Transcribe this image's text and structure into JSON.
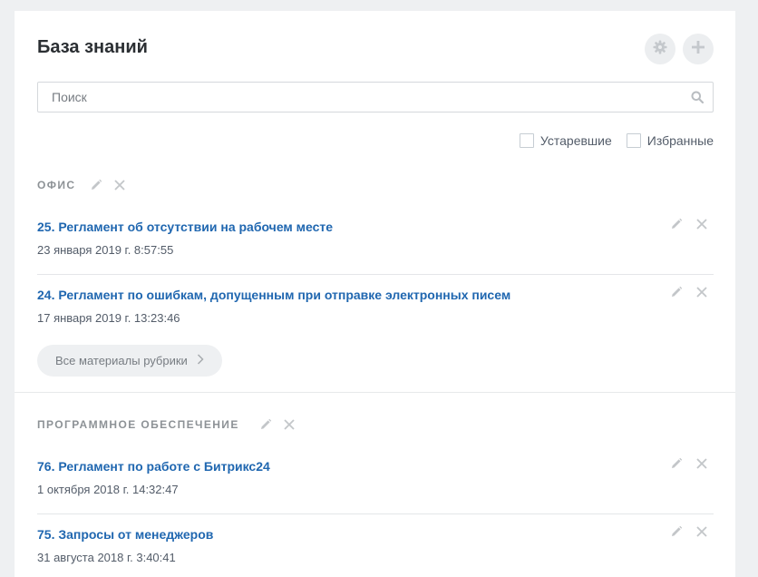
{
  "header": {
    "title": "База знаний"
  },
  "search": {
    "placeholder": "Поиск"
  },
  "filters": [
    {
      "label": "Устаревшие",
      "checked": false
    },
    {
      "label": "Избранные",
      "checked": false
    }
  ],
  "sections": [
    {
      "title": "ОФИС",
      "articles": [
        {
          "title": "25. Регламент об отсутствии на рабочем месте",
          "date": "23 января 2019 г. 8:57:55"
        },
        {
          "title": "24. Регламент по ошибкам, допущенным при отправке электронных писем",
          "date": "17 января 2019 г. 13:23:46"
        }
      ],
      "all_label": "Все материалы рубрики"
    },
    {
      "title": "ПРОГРАММНОЕ ОБЕСПЕЧЕНИЕ",
      "articles": [
        {
          "title": "76. Регламент по работе с Битрикс24",
          "date": "1 октября 2018 г. 14:32:47"
        },
        {
          "title": "75. Запросы от менеджеров",
          "date": "31 августа 2018 г. 3:40:41"
        }
      ]
    }
  ],
  "colors": {
    "link": "#2067b0",
    "background": "#eef0f2",
    "panel": "#ffffff"
  },
  "icons": {
    "settings": "gear-icon",
    "add": "plus-icon",
    "search": "search-icon",
    "edit": "pencil-icon",
    "delete": "close-icon",
    "more": "chevron-right-icon"
  }
}
